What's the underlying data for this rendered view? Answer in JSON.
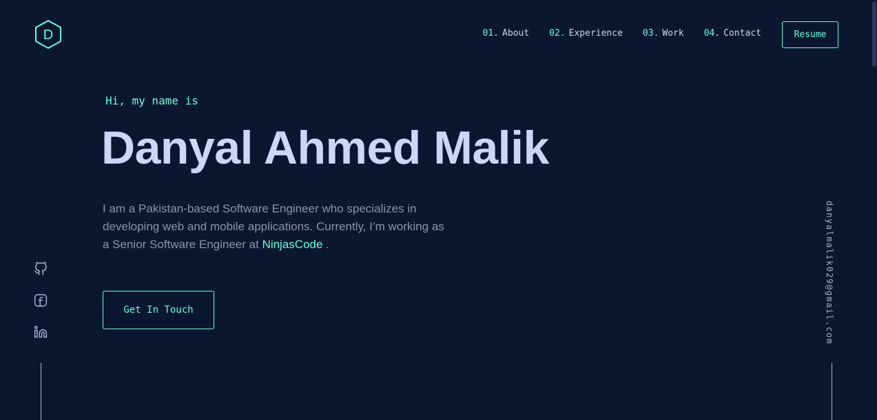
{
  "logo": {
    "letter": "D",
    "icon": "hexagon-logo-icon"
  },
  "nav": {
    "items": [
      {
        "num": "01.",
        "label": "About"
      },
      {
        "num": "02.",
        "label": "Experience"
      },
      {
        "num": "03.",
        "label": "Work"
      },
      {
        "num": "04.",
        "label": "Contact"
      }
    ],
    "resume_label": "Resume"
  },
  "hero": {
    "greeting": "Hi, my name is",
    "name": "Danyal Ahmed Malik",
    "bio_text": "I am a Pakistan-based Software Engineer who specializes in developing web and mobile applications. Currently, I’m working as a Senior Software Engineer at",
    "bio_link": "NinjasCode",
    "bio_end": " .",
    "cta_label": "Get In Touch"
  },
  "socials": [
    {
      "name": "github-icon"
    },
    {
      "name": "facebook-icon"
    },
    {
      "name": "linkedin-icon"
    }
  ],
  "email": "danyalmalik029@gmail.com",
  "colors": {
    "background": "#0b1730",
    "accent": "#64ffda",
    "heading": "#ccd6f6",
    "body": "#8892b0"
  }
}
